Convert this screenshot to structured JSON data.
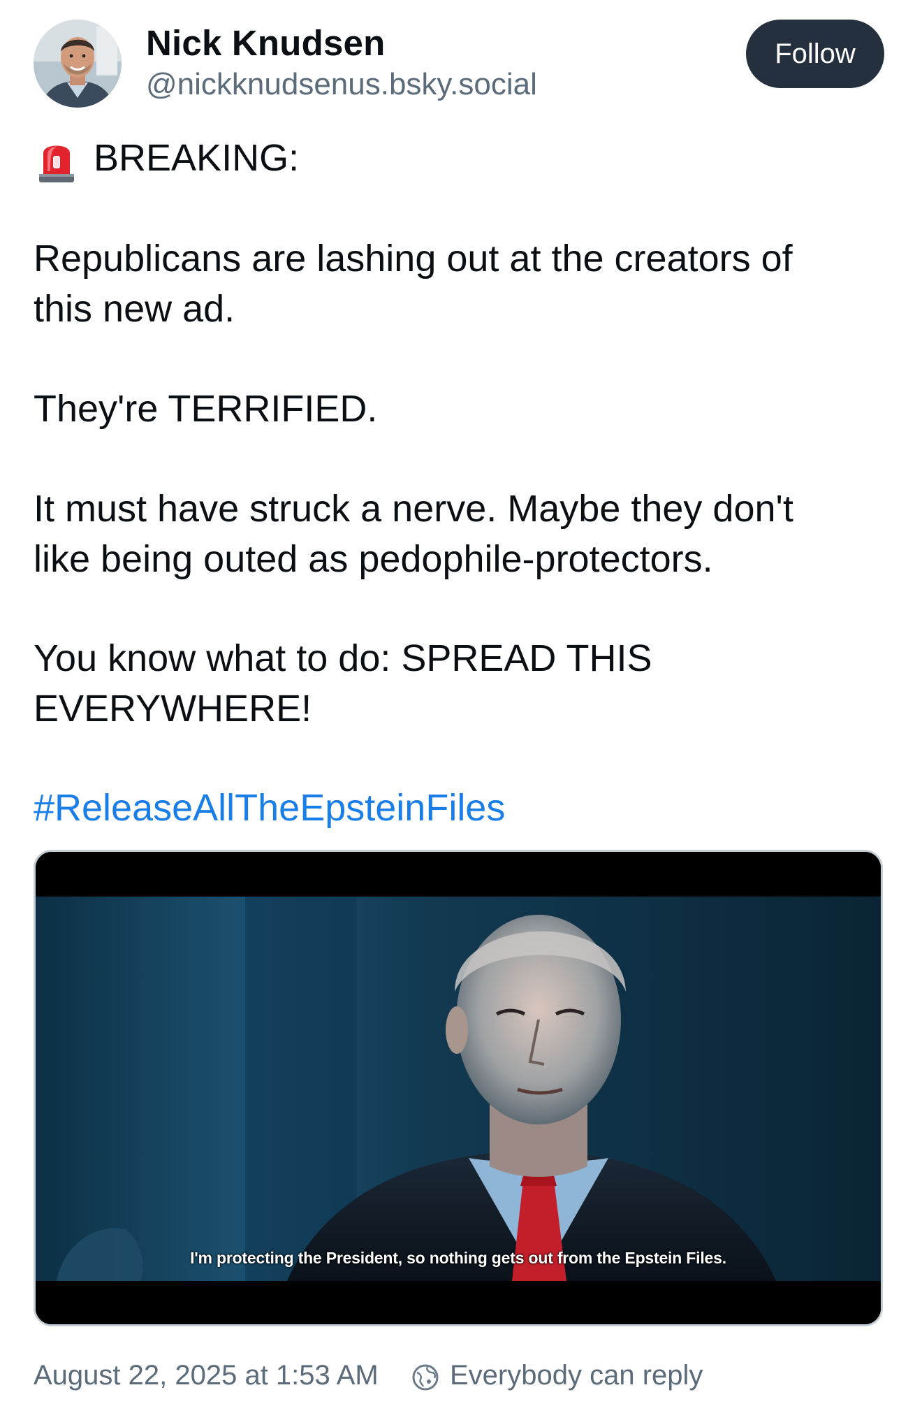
{
  "author": {
    "display_name": "Nick Knudsen",
    "handle": "@nickknudsenus.bsky.social",
    "avatar_icon": "avatar"
  },
  "header": {
    "follow_label": "Follow"
  },
  "post": {
    "breaking_label": "BREAKING:",
    "siren_icon": "rotating-light-emoji",
    "lines": [
      "Republicans are lashing out at the creators of",
      "this new ad.",
      "They're TERRIFIED.",
      "It must have struck a nerve. Maybe they don't",
      "like being outed as pedophile-protectors.",
      "You know what to do: SPREAD THIS",
      "EVERYWHERE!"
    ],
    "hashtag": "#ReleaseAllTheEpsteinFiles",
    "hashtag_color": "#1a7ee8"
  },
  "video": {
    "subtitle": "I'm protecting the President, so nothing gets out from the Epstein Files."
  },
  "footer": {
    "timestamp": "August 22, 2025 at 1:53 AM",
    "reply_setting": "Everybody can reply",
    "reply_icon": "globe-reply-icon"
  },
  "colors": {
    "follow_bg": "#24303d",
    "muted_text": "#5b6b7a",
    "link": "#1a7ee8"
  }
}
